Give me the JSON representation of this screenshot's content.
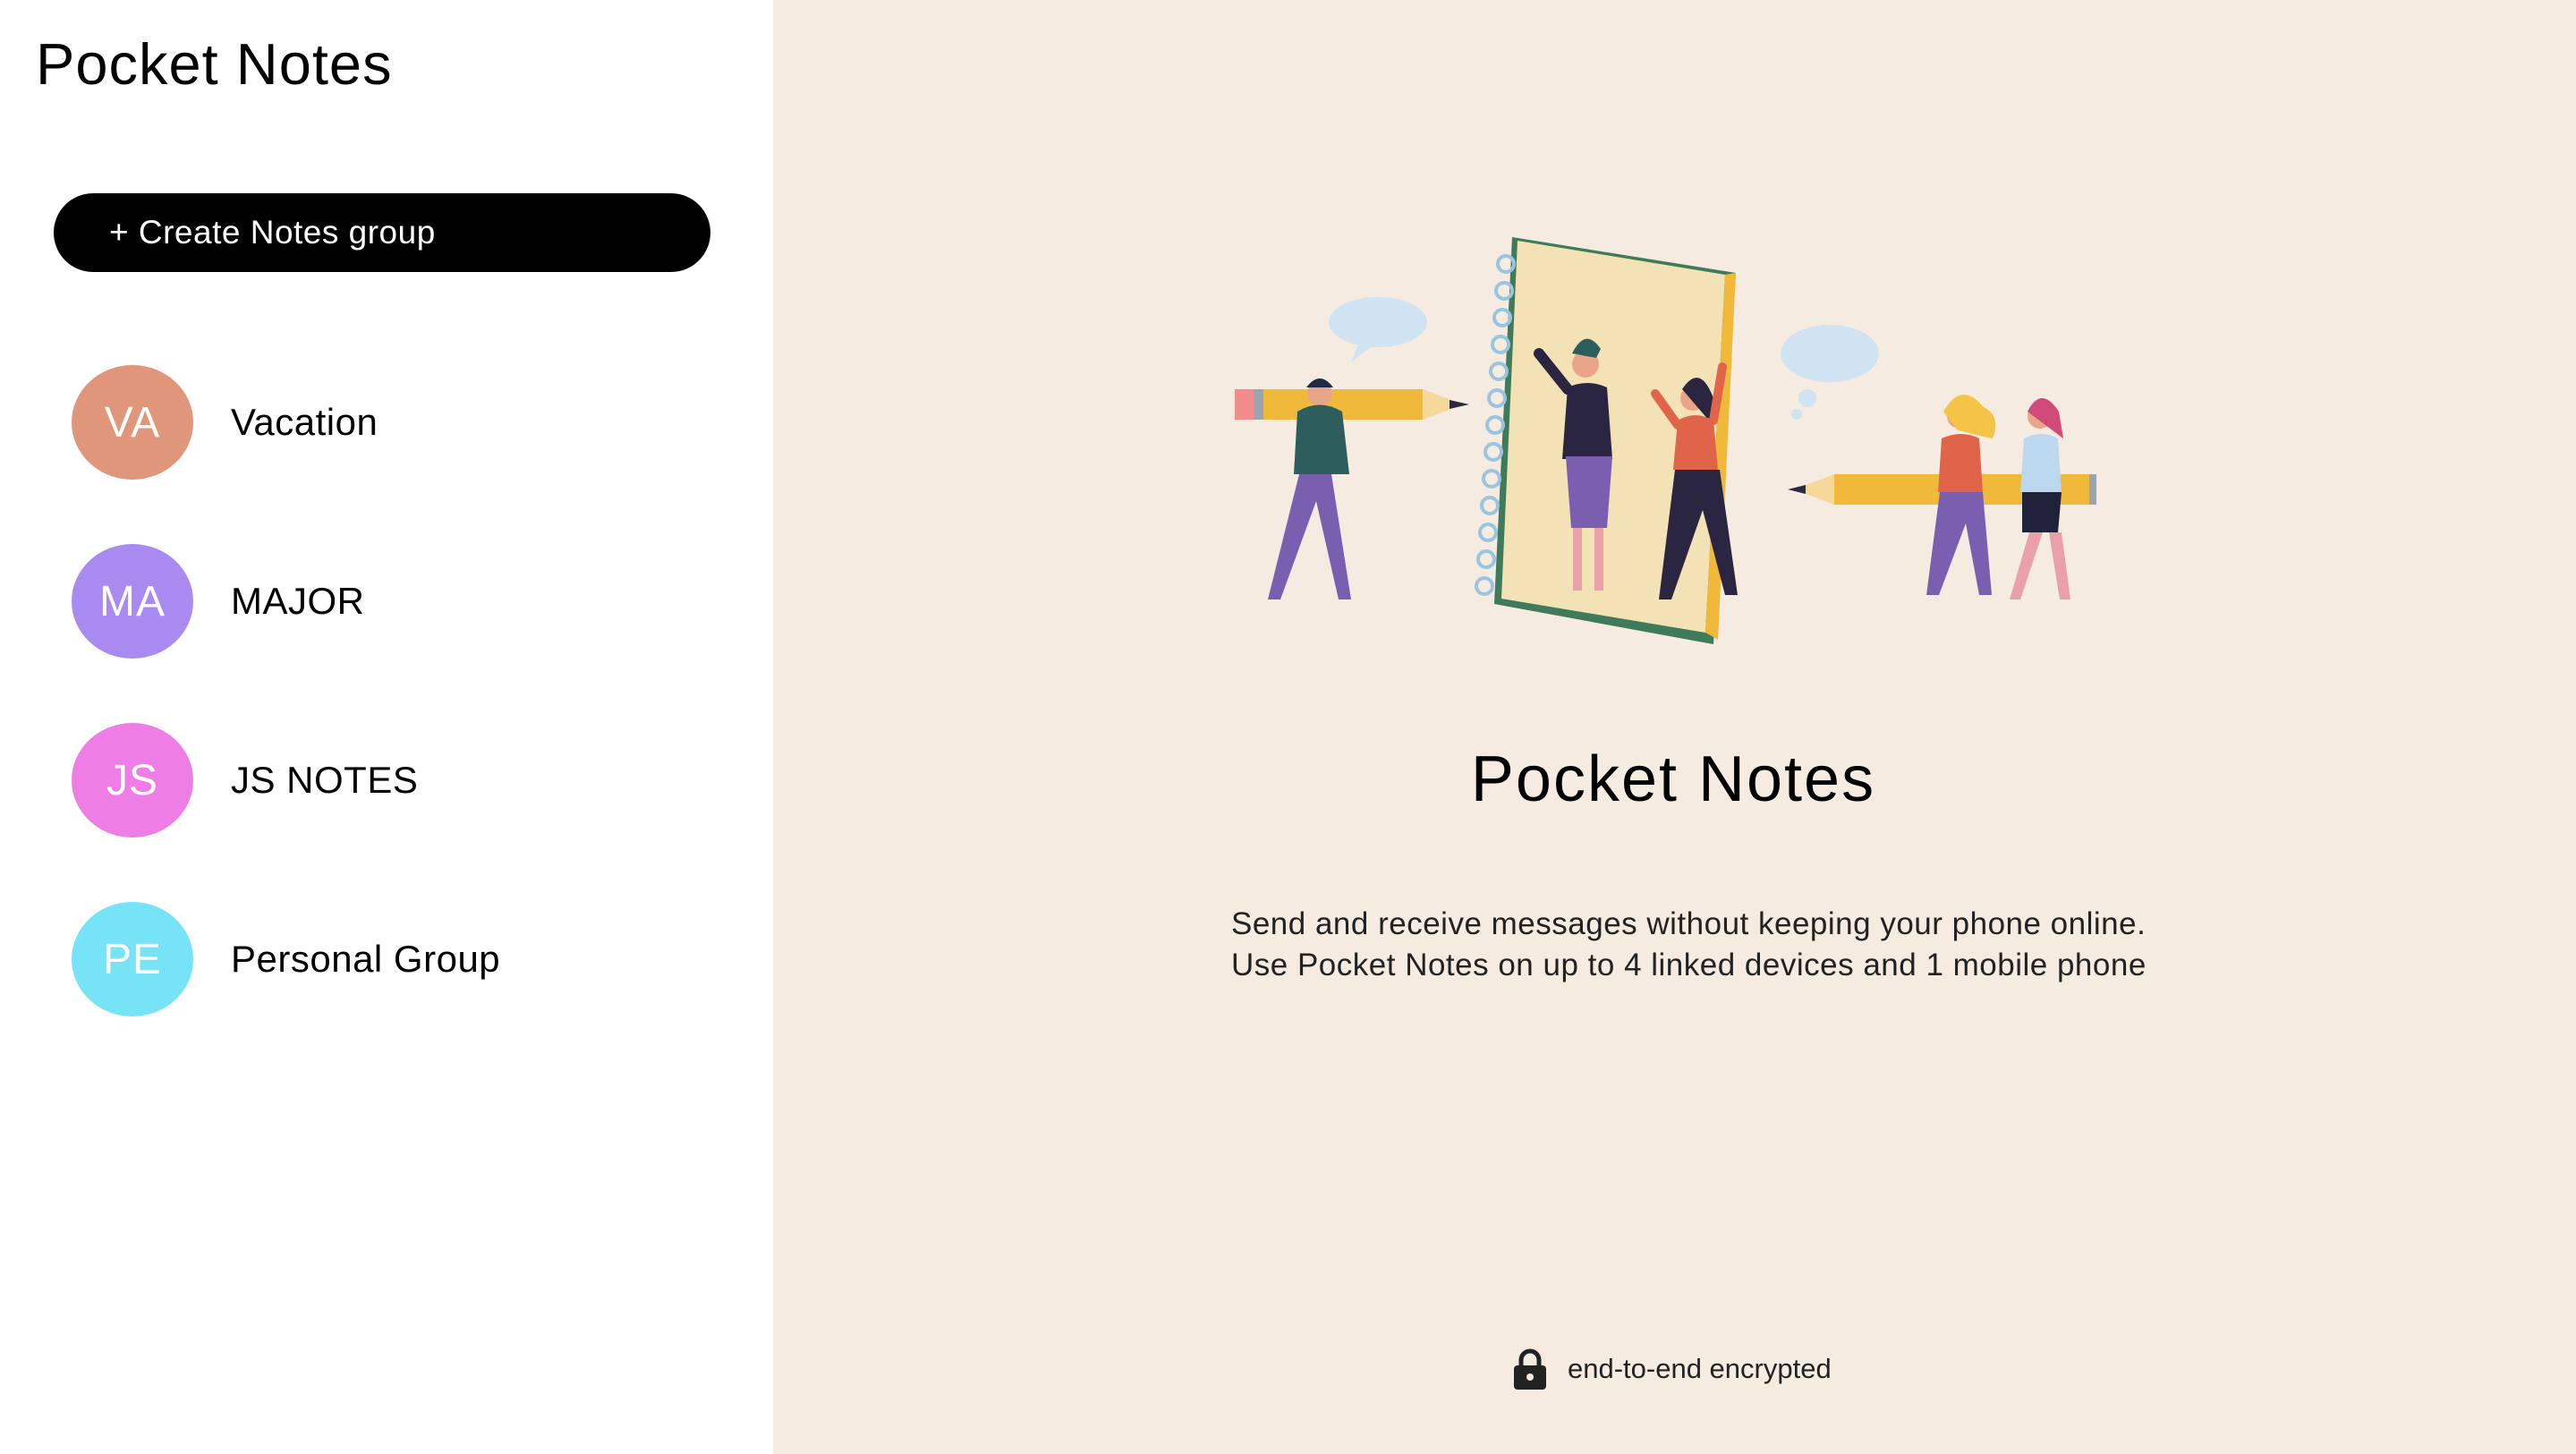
{
  "sidebar": {
    "title": "Pocket Notes",
    "create_button_label": "+ Create Notes group",
    "groups": [
      {
        "initials": "VA",
        "name": "Vacation",
        "color": "#e0967a"
      },
      {
        "initials": "MA",
        "name": "MAJOR",
        "color": "#a98af0"
      },
      {
        "initials": "JS",
        "name": "JS NOTES",
        "color": "#ee7ee6"
      },
      {
        "initials": "PE",
        "name": "Personal Group",
        "color": "#76e3f7"
      }
    ]
  },
  "main": {
    "illustration_icon": "people-with-notebook-and-pencils-illustration",
    "title": "Pocket Notes",
    "description_line1": "Send and receive messages without keeping your phone online.",
    "description_line2": "Use Pocket Notes on up to 4 linked devices and 1 mobile phone",
    "footer_icon": "lock-icon",
    "footer_text": "end-to-end encrypted",
    "background_color": "#f5ebe0"
  }
}
